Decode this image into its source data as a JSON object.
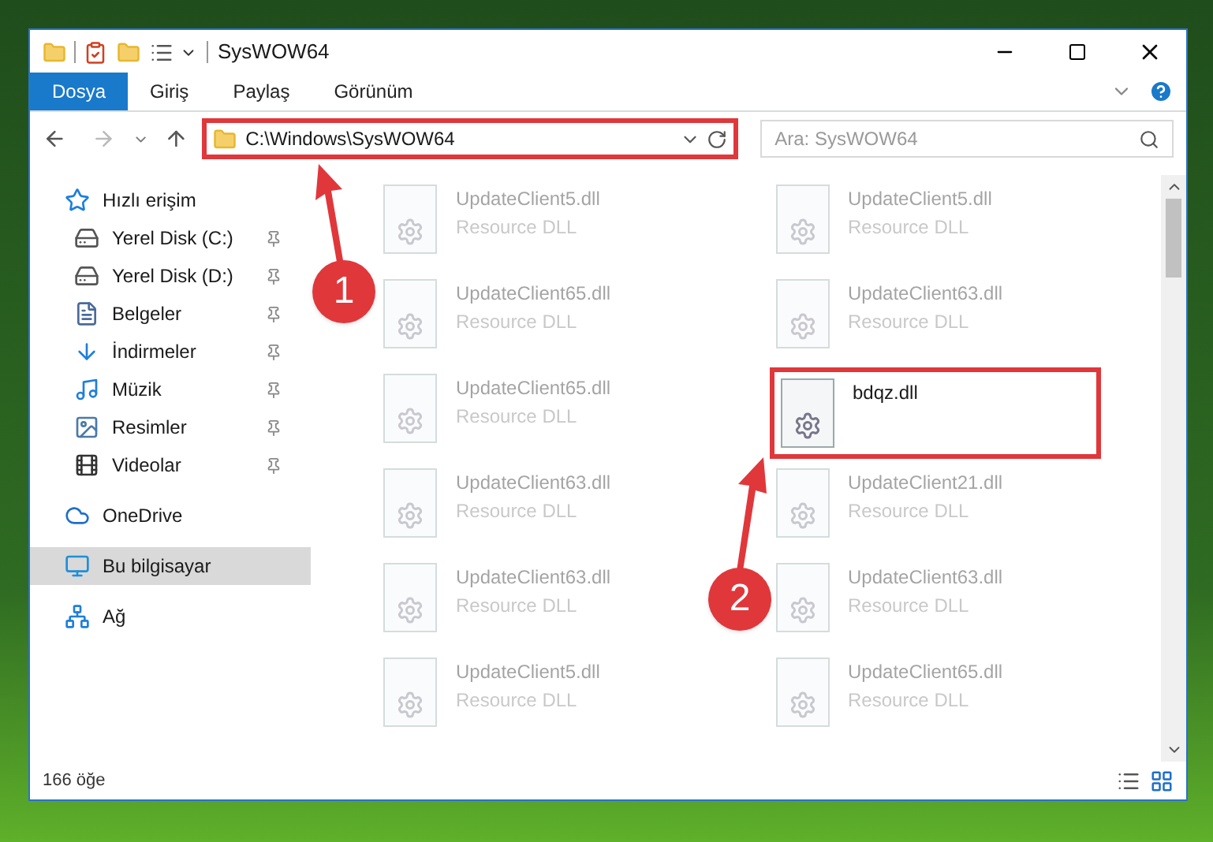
{
  "window": {
    "title": "SysWOW64"
  },
  "ribbon_tabs": [
    {
      "label": "Dosya",
      "selected": true
    },
    {
      "label": "Giriş",
      "selected": false
    },
    {
      "label": "Paylaş",
      "selected": false
    },
    {
      "label": "Görünüm",
      "selected": false
    }
  ],
  "address_bar": {
    "path": "C:\\Windows\\SysWOW64",
    "highlighted": true
  },
  "search": {
    "placeholder": "Ara: SysWOW64"
  },
  "sidebar": {
    "items": [
      {
        "label": "Hızlı erişim",
        "kind": "quick",
        "selected": false,
        "pinned": false,
        "children": [
          {
            "label": "Yerel Disk (C:)",
            "kind": "disk",
            "selected": false,
            "pinned": true
          },
          {
            "label": "Yerel Disk (D:)",
            "kind": "disk",
            "selected": false,
            "pinned": true
          },
          {
            "label": "Belgeler",
            "kind": "docs",
            "selected": false,
            "pinned": true
          },
          {
            "label": "İndirmeler",
            "kind": "downloads",
            "selected": false,
            "pinned": true
          },
          {
            "label": "Müzik",
            "kind": "music",
            "selected": false,
            "pinned": true
          },
          {
            "label": "Resimler",
            "kind": "pictures",
            "selected": false,
            "pinned": true
          },
          {
            "label": "Videolar",
            "kind": "videos",
            "selected": false,
            "pinned": true
          }
        ]
      },
      {
        "label": "OneDrive",
        "kind": "cloud",
        "selected": false,
        "pinned": false
      },
      {
        "label": "Bu bilgisayar",
        "kind": "pc",
        "selected": true,
        "pinned": false
      },
      {
        "label": "Ağ",
        "kind": "network",
        "selected": false,
        "pinned": false
      }
    ]
  },
  "files": [
    {
      "name": "UpdateClient5.dll",
      "type": "Resource DLL",
      "dimmed": true,
      "highlighted": false
    },
    {
      "name": "UpdateClient5.dll",
      "type": "Resource DLL",
      "dimmed": true,
      "highlighted": false
    },
    {
      "name": "UpdateClient65.dll",
      "type": "Resource DLL",
      "dimmed": true,
      "highlighted": false
    },
    {
      "name": "UpdateClient63.dll",
      "type": "Resource DLL",
      "dimmed": true,
      "highlighted": false
    },
    {
      "name": "UpdateClient65.dll",
      "type": "Resource DLL",
      "dimmed": true,
      "highlighted": false
    },
    {
      "name": "bdqz.dll",
      "dimmed": false,
      "highlighted": true
    },
    {
      "name": "UpdateClient63.dll",
      "type": "Resource DLL",
      "dimmed": true,
      "highlighted": false
    },
    {
      "name": "UpdateClient21.dll",
      "type": "Resource DLL",
      "dimmed": true,
      "highlighted": false
    },
    {
      "name": "UpdateClient63.dll",
      "type": "Resource DLL",
      "dimmed": true,
      "highlighted": false
    },
    {
      "name": "UpdateClient63.dll",
      "type": "Resource DLL",
      "dimmed": true,
      "highlighted": false
    },
    {
      "name": "UpdateClient5.dll",
      "type": "Resource DLL",
      "dimmed": true,
      "highlighted": false
    },
    {
      "name": "UpdateClient65.dll",
      "type": "Resource DLL",
      "dimmed": true,
      "highlighted": false
    }
  ],
  "status_bar": {
    "count": "166 öğe"
  },
  "annotations": [
    {
      "label": "1"
    },
    {
      "label": "2"
    }
  ]
}
